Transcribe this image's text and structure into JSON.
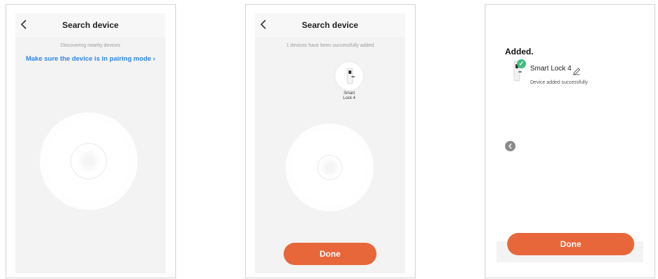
{
  "screen1": {
    "title": "Search device",
    "subtitle": "Discovering nearby devices",
    "pairing_link": "Make sure the device is in pairing mode ›"
  },
  "screen2": {
    "title": "Search device",
    "subtitle": "1 devices have been successfully added",
    "device_line1": "Smart",
    "device_line2": "Lock 4",
    "done_label": "Done"
  },
  "screen3": {
    "added_title": "Added.",
    "device_name": "Smart Lock 4",
    "device_status": "Device added successfully",
    "done_label": "Done"
  },
  "icons": {
    "back": "chevron-left-icon",
    "edit": "pencil-icon",
    "check": "check-badge-icon",
    "scroll": "scroll-left-icon"
  },
  "colors": {
    "accent": "#e8673a",
    "link": "#2b86e8",
    "success": "#3dbf7b"
  }
}
